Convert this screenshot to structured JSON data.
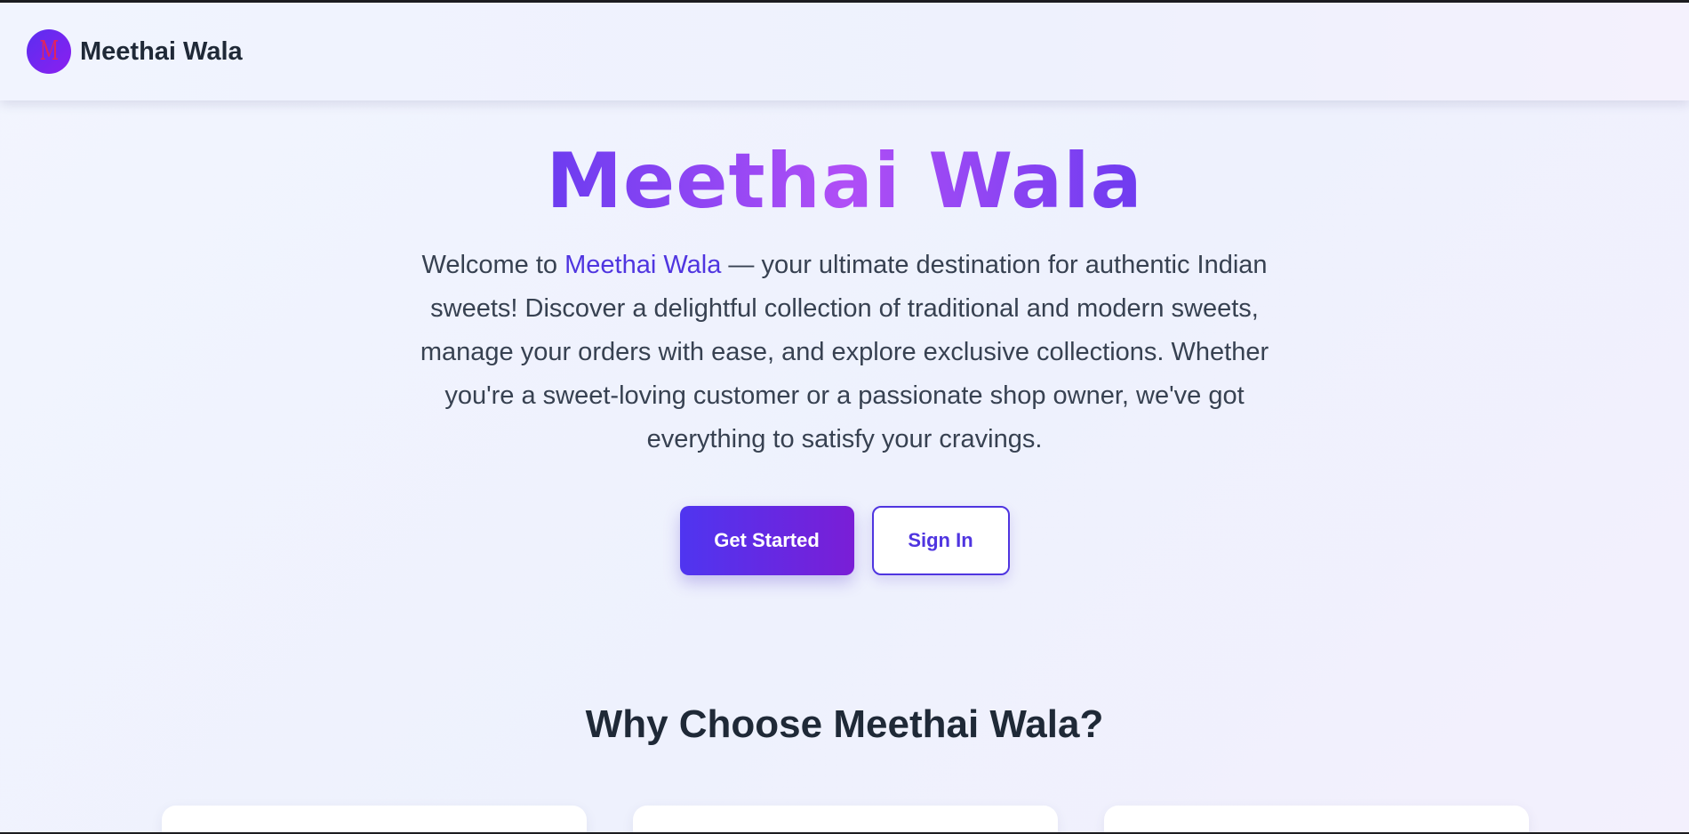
{
  "nav": {
    "logo_letter": "M",
    "brand_name": "Meethai Wala"
  },
  "hero": {
    "title": "Meethai Wala",
    "intro_prefix": "Welcome to ",
    "intro_brand": "Meethai Wala",
    "intro_rest": " — your ultimate destination for authentic Indian sweets! Discover a delightful collection of traditional and modern sweets, manage your orders with ease, and explore exclusive collections. Whether you're a sweet-loving customer or a passionate shop owner, we've got everything to satisfy your cravings.",
    "get_started_label": "Get Started",
    "sign_in_label": "Sign In"
  },
  "features": {
    "title": "Why Choose Meethai Wala?"
  },
  "colors": {
    "accent": "#4f35e0",
    "gradient_start": "#4f35f0",
    "gradient_end": "#7a1ed6",
    "title_gradient_mid": "#b04ff6"
  }
}
